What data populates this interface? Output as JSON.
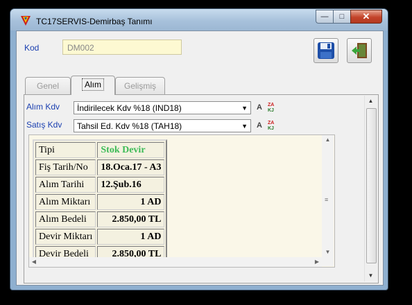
{
  "window": {
    "title": "TC17SERVIS-Demirbaş Tanımı"
  },
  "kod": {
    "label": "Kod",
    "value": "DM002"
  },
  "tabs": [
    {
      "label": "Genel"
    },
    {
      "label": "Alım"
    },
    {
      "label": "Gelişmiş"
    }
  ],
  "alim_kdv": {
    "label": "Alım Kdv",
    "value": "İndirilecek Kdv %18 (IND18)"
  },
  "satis_kdv": {
    "label": "Satış Kdv",
    "value": "Tahsil Ed. Kdv %18 (TAH18)"
  },
  "icons": {
    "app": "app-logo-icon",
    "save": "floppy-disk-icon",
    "exit": "exit-door-icon",
    "a": "a-letter-icon",
    "sort": "az-sort-icon"
  },
  "colors": {
    "label_blue": "#1a3fb0",
    "memo_bg": "#faf7e8",
    "kod_bg": "#fdf9d2",
    "green": "#3dbb57"
  },
  "info_table": [
    {
      "label": "Tipi",
      "value": "Stok Devir"
    },
    {
      "label": "Fiş Tarih/No",
      "value": "18.Oca.17 - A3"
    },
    {
      "label": "Alım Tarihi",
      "value": "12.Şub.16"
    },
    {
      "label": "Alım Miktarı",
      "value": "1 AD"
    },
    {
      "label": "Alım Bedeli",
      "value": "2.850,00 TL"
    },
    {
      "label": "Devir Miktarı",
      "value": "1 AD"
    },
    {
      "label": "Devir Bedeli",
      "value": "2.850,00 TL"
    }
  ]
}
